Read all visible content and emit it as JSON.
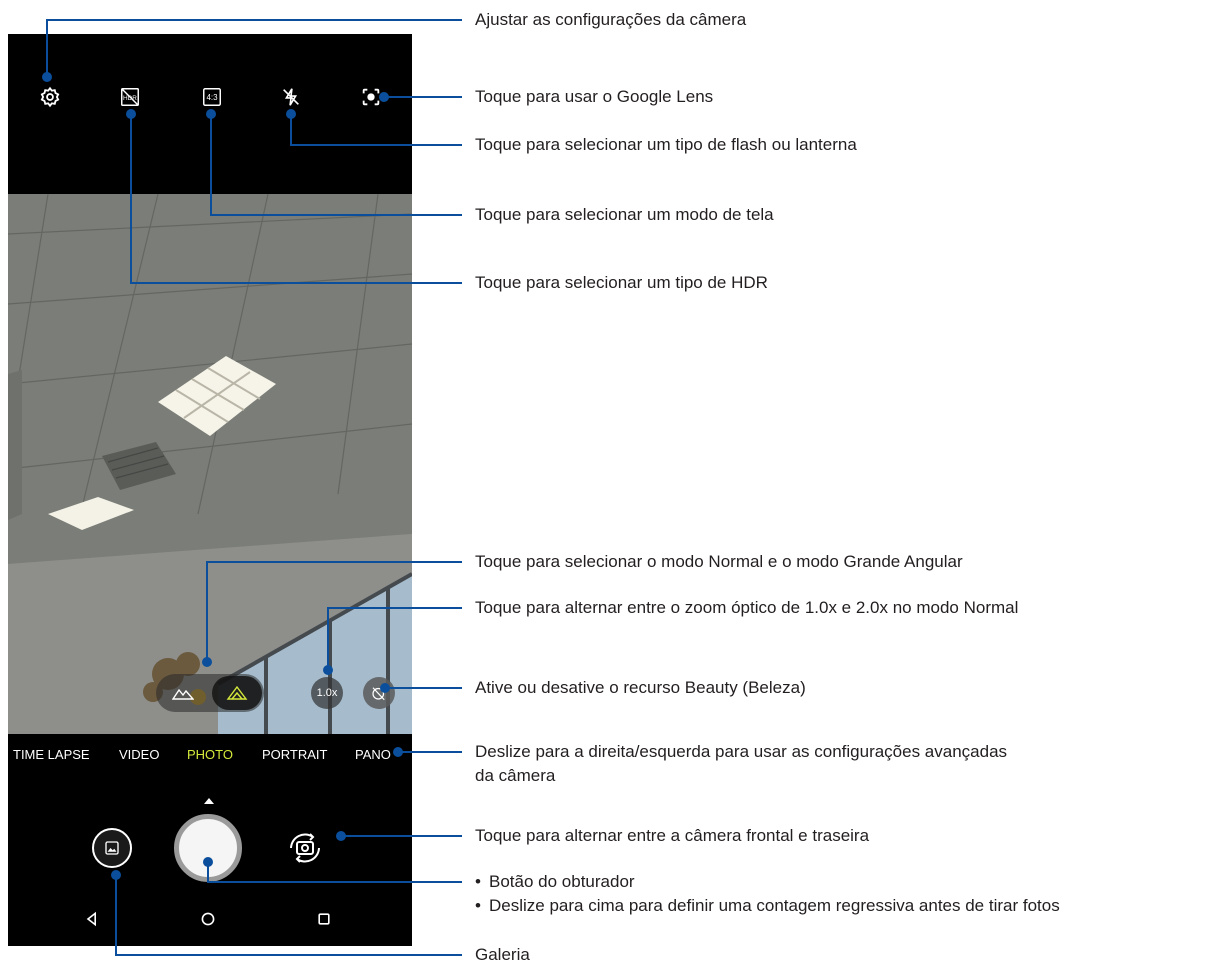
{
  "accent_color": "#0b4f9c",
  "top_icons": [
    "settings-icon",
    "hdr-off-icon",
    "aspect-ratio-icon",
    "flash-off-icon",
    "google-lens-icon"
  ],
  "aspect_label": "4:3",
  "zoom_label": "1.0x",
  "modes": [
    "TIME LAPSE",
    "VIDEO",
    "PHOTO",
    "PORTRAIT",
    "PANO"
  ],
  "active_mode": "PHOTO",
  "mode_active_color": "#d6ea3b",
  "callouts": {
    "settings": "Ajustar as configurações da câmera",
    "lens": "Toque para usar o Google Lens",
    "flash": "Toque para selecionar um tipo de flash ou lanterna",
    "screen_mode": "Toque para selecionar um modo de tela",
    "hdr": "Toque para selecionar um tipo de HDR",
    "lens_mode": "Toque para selecionar o modo Normal e o modo Grande Angular",
    "zoom": "Toque para alternar entre o zoom óptico de 1.0x e 2.0x no modo Normal",
    "beauty": "Ative ou desative o recurso Beauty (Beleza)",
    "swipe_modes_1": "Deslize para a direita/esquerda para usar as configurações avançadas",
    "swipe_modes_2": "da câmera",
    "switch_camera": "Toque para alternar entre a câmera frontal e traseira",
    "shutter_1": "Botão do obturador",
    "shutter_2": "Deslize para cima para definir uma contagem regressiva antes de tirar fotos",
    "gallery": "Galeria"
  }
}
